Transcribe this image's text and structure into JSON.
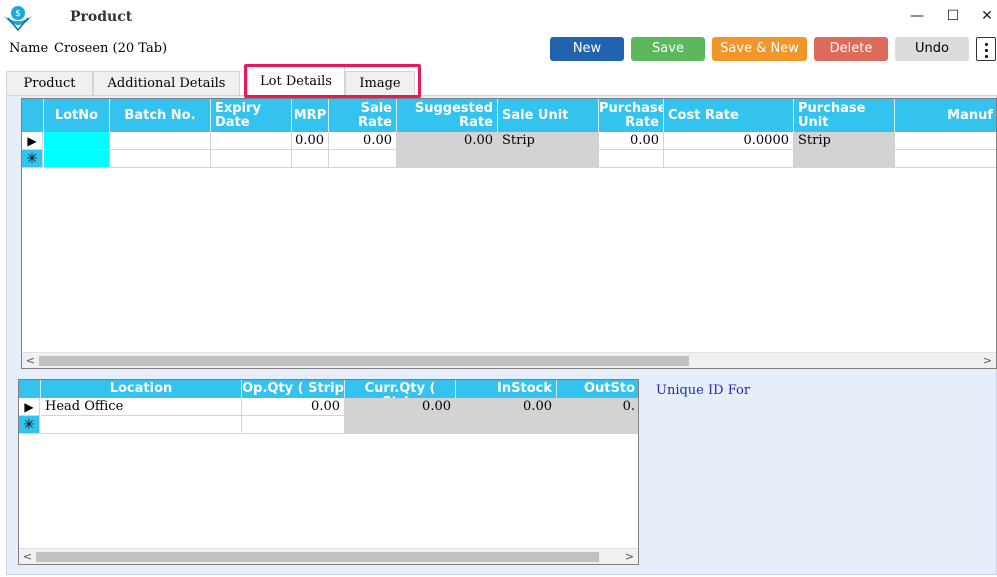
{
  "window": {
    "title": "Product",
    "minimize": "—",
    "maximize": "☐",
    "close": "✕"
  },
  "name": {
    "label": "Name",
    "value": "Croseen (20 Tab)"
  },
  "toolbar": {
    "new": "New",
    "save": "Save",
    "save_new": "Save & New",
    "delete": "Delete",
    "undo": "Undo"
  },
  "tabs": [
    {
      "label": "Product"
    },
    {
      "label": "Additional Details"
    },
    {
      "label": "Lot Details"
    },
    {
      "label": "Image"
    }
  ],
  "lot_grid": {
    "headers": [
      "LotNo",
      "Batch No.",
      "Expiry\nDate",
      "MRP",
      "Sale\nRate",
      "Suggested\nRate",
      "Sale Unit",
      "Purchase\nRate",
      "Cost Rate",
      "Purchase\nUnit",
      "Manuf"
    ],
    "row": {
      "lotno": "",
      "batch": "",
      "expiry": "",
      "mrp": "0.00",
      "sale_rate": "0.00",
      "suggested_rate": "0.00",
      "sale_unit": "Strip",
      "purchase_rate": "0.00",
      "cost_rate": "0.0000",
      "purchase_unit": "Strip",
      "manuf": ""
    },
    "current_row_marker": "▶",
    "new_row_marker": "✳"
  },
  "location_grid": {
    "headers": [
      "Location",
      "Op.Qty ( Strip",
      "Curr.Qty ( Strip",
      "InStock",
      "OutSto"
    ],
    "row": {
      "location": "Head Office",
      "op_qty": "0.00",
      "curr_qty": "0.00",
      "instock": "0.00",
      "outstock": "0."
    },
    "current_row_marker": "▶",
    "new_row_marker": "✳"
  },
  "scroll": {
    "left": "<",
    "right": ">"
  },
  "unique_id_label": "Unique ID For",
  "colors": {
    "header_bg": "#34c3ef",
    "highlight": "#e5195f",
    "new": "#2163ad",
    "save": "#5cb85c",
    "save_new": "#f0962a",
    "delete": "#dd6b5c"
  }
}
